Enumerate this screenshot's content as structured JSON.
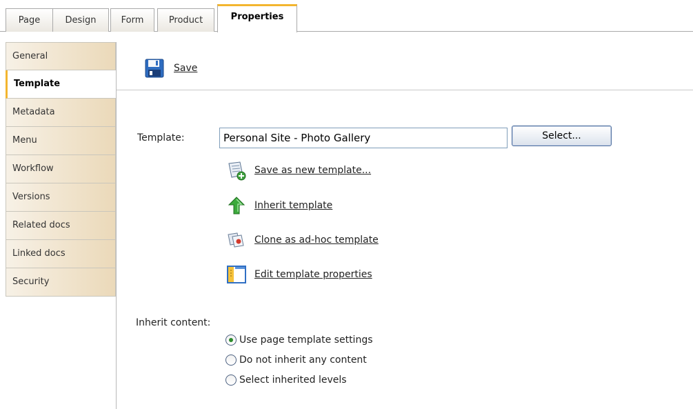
{
  "tabs": [
    {
      "label": "Page"
    },
    {
      "label": "Design"
    },
    {
      "label": "Form"
    },
    {
      "label": "Product"
    },
    {
      "label": "Properties",
      "active": true
    }
  ],
  "sidebar": {
    "items": [
      {
        "label": "General"
      },
      {
        "label": "Template",
        "active": true
      },
      {
        "label": "Metadata"
      },
      {
        "label": "Menu"
      },
      {
        "label": "Workflow"
      },
      {
        "label": "Versions"
      },
      {
        "label": "Related docs"
      },
      {
        "label": "Linked docs"
      },
      {
        "label": "Security"
      }
    ]
  },
  "toolbar": {
    "save_label": "Save",
    "save_icon": "floppy-disk-icon"
  },
  "form": {
    "template_label": "Template:",
    "template_value": "Personal Site - Photo Gallery",
    "select_button": "Select...",
    "actions": [
      {
        "label": "Save as new template...",
        "icon": "save-new-template-icon"
      },
      {
        "label": "Inherit template",
        "icon": "inherit-arrow-icon"
      },
      {
        "label": "Clone as ad-hoc template",
        "icon": "clone-template-icon"
      },
      {
        "label": "Edit template properties",
        "icon": "edit-properties-icon"
      }
    ],
    "inherit_content_label": "Inherit content:",
    "inherit_options": [
      {
        "label": "Use page template settings",
        "checked": true
      },
      {
        "label": "Do not inherit any content",
        "checked": false
      },
      {
        "label": "Select inherited levels",
        "checked": false
      }
    ]
  },
  "colors": {
    "accent": "#f3b52f",
    "sidebar_gradient_end": "#ebd9b9",
    "input_border": "#7f9db9"
  }
}
